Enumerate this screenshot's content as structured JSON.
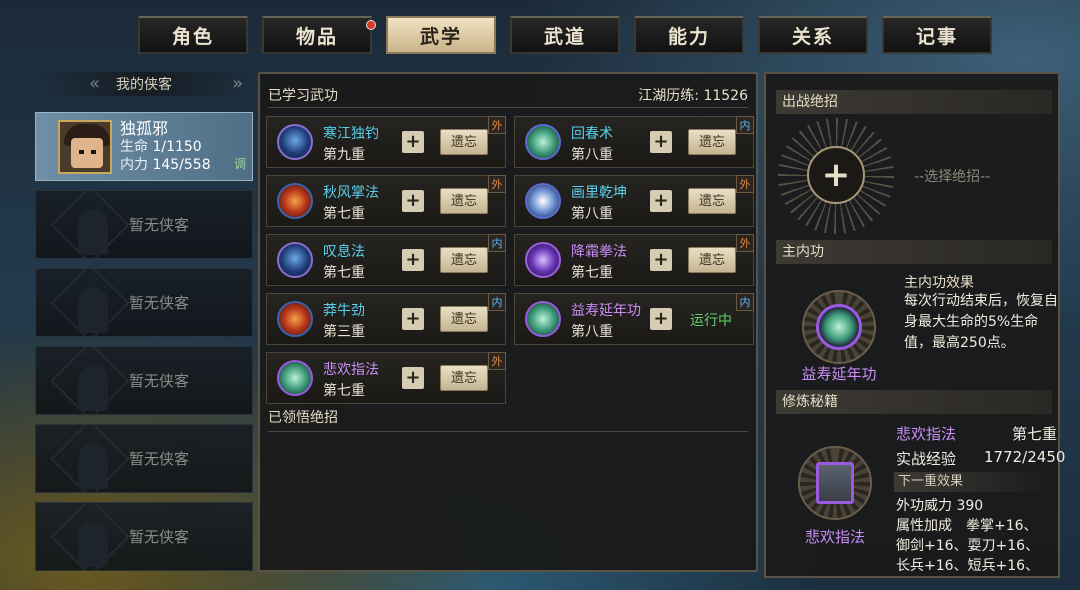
{
  "tabs": [
    {
      "label": "角色",
      "active": false
    },
    {
      "label": "物品",
      "active": false,
      "notify": true
    },
    {
      "label": "武学",
      "active": true
    },
    {
      "label": "武道",
      "active": false
    },
    {
      "label": "能力",
      "active": false
    },
    {
      "label": "关系",
      "active": false
    },
    {
      "label": "记事",
      "active": false
    }
  ],
  "heroes": {
    "title": "我的侠客",
    "current": {
      "name": "独孤邪",
      "hp_label": "生命",
      "hp": "1/1150",
      "mp_label": "内力",
      "mp": "145/558",
      "tune": "调"
    },
    "empty_text": "暂无侠客",
    "empty_slots": 5
  },
  "skills": {
    "learned_title": "已学习武功",
    "exp_text": "江湖历练: 11526",
    "forget_label": "遗忘",
    "running_label": "运行中",
    "items": [
      {
        "name": "寒江独钓",
        "level": "第九重",
        "type": "外",
        "color": "cyan",
        "icon": "blade-swirl-icon"
      },
      {
        "name": "回春术",
        "level": "第八重",
        "type": "内",
        "color": "cyan",
        "icon": "healing-flask-icon"
      },
      {
        "name": "秋风掌法",
        "level": "第七重",
        "type": "外",
        "color": "cyan",
        "icon": "flame-palm-icon"
      },
      {
        "name": "画里乾坤",
        "level": "第八重",
        "type": "外",
        "color": "cyan",
        "icon": "brush-icon"
      },
      {
        "name": "叹息法",
        "level": "第七重",
        "type": "内",
        "color": "cyan",
        "icon": "claw-icon"
      },
      {
        "name": "降霜拳法",
        "level": "第七重",
        "type": "外",
        "color": "purple",
        "icon": "frost-fist-icon"
      },
      {
        "name": "莽牛劲",
        "level": "第三重",
        "type": "内",
        "color": "cyan",
        "icon": "bull-icon"
      },
      {
        "name": "益寿延年功",
        "level": "第八重",
        "type": "内",
        "color": "purple",
        "icon": "longevity-icon",
        "running": true
      },
      {
        "name": "悲欢指法",
        "level": "第七重",
        "type": "外",
        "color": "purple",
        "icon": "finger-strike-icon"
      }
    ],
    "comprehended_title": "已领悟绝招"
  },
  "right": {
    "ultimate_title": "出战绝招",
    "select_hint": "--选择绝招--",
    "main_inner_title": "主内功",
    "main_inner_effect_title": "主内功效果",
    "main_inner_effect": "每次行动结束后，恢复自身最大生命的5%生命值，最高250点。",
    "main_inner_name": "益寿延年功",
    "training_title": "修炼秘籍",
    "training_name": "悲欢指法",
    "training_level": "第七重",
    "training_exp_label": "实战经验",
    "training_exp": "1772/2450",
    "next_title": "下一重效果",
    "next_lines": [
      "外功威力 390",
      "属性加成　拳掌+16、",
      "御剑+16、耍刀+16、",
      "长兵+16、短兵+16、"
    ],
    "book_label": "悲欢指法"
  },
  "colors": {
    "cyan": "#5ad0ec",
    "purple": "#c98cf5",
    "running": "#5fd06a",
    "external_badge": "#e08840",
    "internal_badge": "#5ab8f0"
  }
}
